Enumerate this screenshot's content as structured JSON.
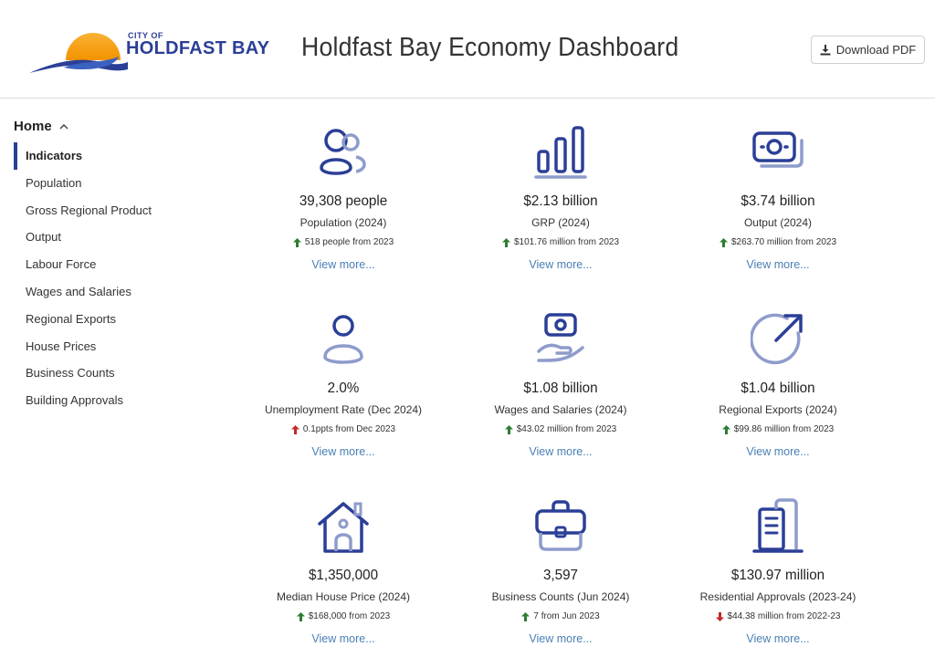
{
  "header": {
    "logo_small": "CITY OF",
    "logo_big": "HOLDFAST BAY",
    "title": "Holdfast Bay Economy Dashboard",
    "pdf_label": "Download PDF"
  },
  "sidebar": {
    "home": "Home",
    "items": [
      {
        "label": "Indicators"
      },
      {
        "label": "Population"
      },
      {
        "label": "Gross Regional Product"
      },
      {
        "label": "Output"
      },
      {
        "label": "Labour Force"
      },
      {
        "label": "Wages and Salaries"
      },
      {
        "label": "Regional Exports"
      },
      {
        "label": "House Prices"
      },
      {
        "label": "Business Counts"
      },
      {
        "label": "Building Approvals"
      }
    ]
  },
  "colors": {
    "brand": "#2b3f97",
    "icon_light": "#8e9ccc",
    "up_green": "#2e7d32",
    "up_red": "#c62828",
    "down_red": "#c62828",
    "link": "#4a7fb5"
  },
  "cards": [
    {
      "icon": "people-icon",
      "value": "39,308 people",
      "label": "Population (2024)",
      "change": "518 people from 2023",
      "arrow": "up",
      "arrow_color": "#2e7d32",
      "view": "View more..."
    },
    {
      "icon": "bar-chart-icon",
      "value": "$2.13 billion",
      "label": "GRP (2024)",
      "change": "$101.76 million from 2023",
      "arrow": "up",
      "arrow_color": "#2e7d32",
      "view": "View more..."
    },
    {
      "icon": "money-icon",
      "value": "$3.74 billion",
      "label": "Output (2024)",
      "change": "$263.70 million from 2023",
      "arrow": "up",
      "arrow_color": "#2e7d32",
      "view": "View more..."
    },
    {
      "icon": "person-icon",
      "value": "2.0%",
      "label": "Unemployment Rate (Dec 2024)",
      "change": "0.1ppts from Dec 2023",
      "arrow": "up",
      "arrow_color": "#c62828",
      "view": "View more..."
    },
    {
      "icon": "hand-money-icon",
      "value": "$1.08 billion",
      "label": "Wages and Salaries (2024)",
      "change": "$43.02 million from 2023",
      "arrow": "up",
      "arrow_color": "#2e7d32",
      "view": "View more..."
    },
    {
      "icon": "export-arrow-icon",
      "value": "$1.04 billion",
      "label": "Regional Exports (2024)",
      "change": "$99.86 million from 2023",
      "arrow": "up",
      "arrow_color": "#2e7d32",
      "view": "View more..."
    },
    {
      "icon": "house-icon",
      "value": "$1,350,000",
      "label": "Median House Price (2024)",
      "change": "$168,000 from 2023",
      "arrow": "up",
      "arrow_color": "#2e7d32",
      "view": "View more..."
    },
    {
      "icon": "briefcase-icon",
      "value": "3,597",
      "label": "Business Counts (Jun 2024)",
      "change": "7 from Jun 2023",
      "arrow": "up",
      "arrow_color": "#2e7d32",
      "view": "View more..."
    },
    {
      "icon": "building-icon",
      "value": "$130.97 million",
      "label": "Residential Approvals (2023-24)",
      "change": "$44.38 million from 2022-23",
      "arrow": "down",
      "arrow_color": "#c62828",
      "view": "View more..."
    }
  ]
}
